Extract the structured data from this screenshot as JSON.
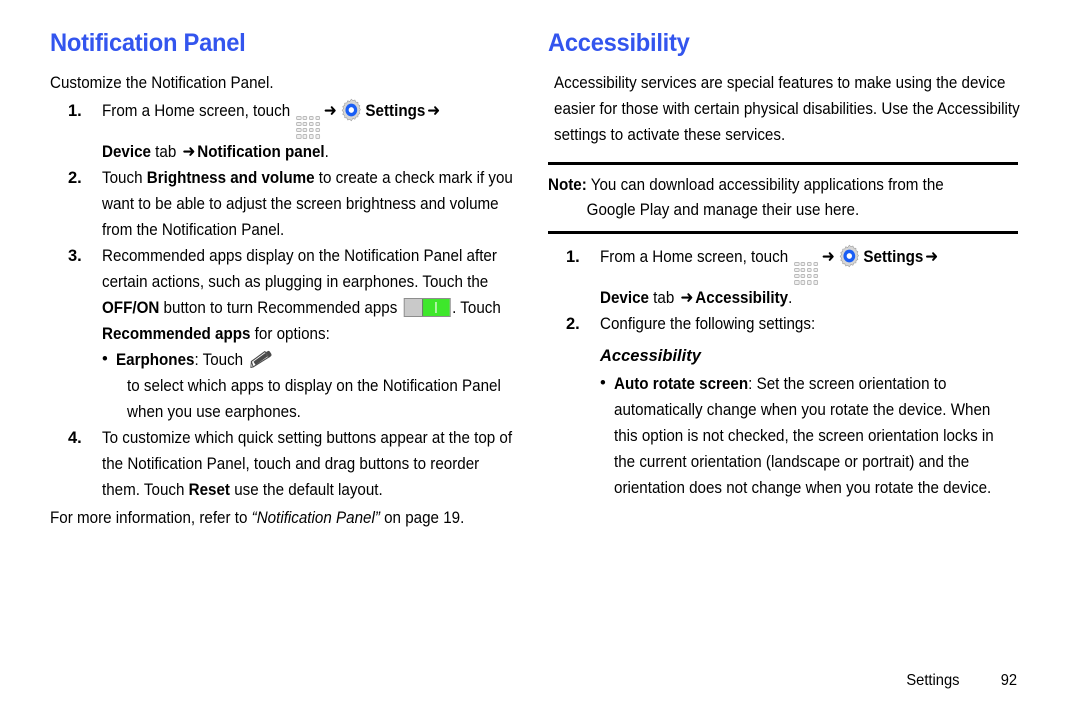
{
  "document": {
    "page_number": "92",
    "footer_label": "Settings"
  },
  "icons": {
    "apps_grid": "apps-grid-icon",
    "gear": "gear-icon",
    "arrow": "➜",
    "toggle": "toggle-switch-icon",
    "pencil": "pencil-icon",
    "bullet": "•"
  },
  "colors": {
    "heading": "#3355ee",
    "toggle_on": "#3ee72b",
    "toggle_off": "#c9c9c9",
    "gear_accent": "#1a5ef5",
    "rule": "#000000"
  },
  "left_column": {
    "title": "Notification Panel",
    "intro": "Customize the Notification Panel.",
    "steps": [
      {
        "num": "1.",
        "parts": {
          "pre": "From a Home screen, touch ",
          "settings_label": "Settings",
          "device_bold": "Device",
          "tab_text": " tab ",
          "target_bold": "Notification panel",
          "period": "."
        }
      },
      {
        "num": "2.",
        "parts": {
          "pre": "Touch ",
          "bold1": "Brightness and volume",
          "post": " to create a check mark if you want to be able to adjust the screen brightness and volume from the Notification Panel."
        }
      },
      {
        "num": "3.",
        "parts": {
          "pre": "Recommended apps display on the Notification Panel after certain actions, such as plugging in earphones. Touch the ",
          "bold1": "OFF/ON",
          "mid": " button to turn Recommended apps ",
          "mid2": ". Touch ",
          "bold2": "Recommended apps",
          "post": " for options:"
        },
        "sub_bullets": [
          {
            "bold": "Earphones",
            "pre": ": Touch ",
            "post": " to select which apps to display on the Notification Panel when you use earphones."
          }
        ]
      },
      {
        "num": "4.",
        "parts": {
          "pre": "To customize which quick setting buttons appear at the top of the Notification Panel, touch and drag buttons to reorder them. Touch ",
          "bold1": "Reset",
          "post": " use the default layout."
        }
      }
    ],
    "closing": {
      "pre": "For more information, refer to ",
      "italic": "“Notification Panel”",
      "post": " on page 19."
    }
  },
  "right_column": {
    "title": "Accessibility",
    "intro": "Accessibility services are special features to make using the device easier for those with certain physical disabilities. Use the Accessibility settings to activate these services.",
    "note": {
      "label": "Note:",
      "line1": " You can download accessibility applications from the",
      "line2": "Google Play and manage their use here."
    },
    "steps": [
      {
        "num": "1.",
        "parts": {
          "pre": "From a Home screen, touch ",
          "settings_label": "Settings",
          "device_bold": "Device",
          "tab_text": " tab ",
          "target_bold": "Accessibility",
          "period": "."
        }
      },
      {
        "num": "2.",
        "parts": {
          "pre": "Configure the following settings:"
        }
      }
    ],
    "sub_heading": "Accessibility",
    "bullets": [
      {
        "bold": "Auto rotate screen",
        "text": ": Set the screen orientation to automatically change when you rotate the device. When this option is not checked, the screen orientation locks in the current orientation (landscape or portrait) and the orientation does not change when you rotate the device."
      }
    ]
  }
}
